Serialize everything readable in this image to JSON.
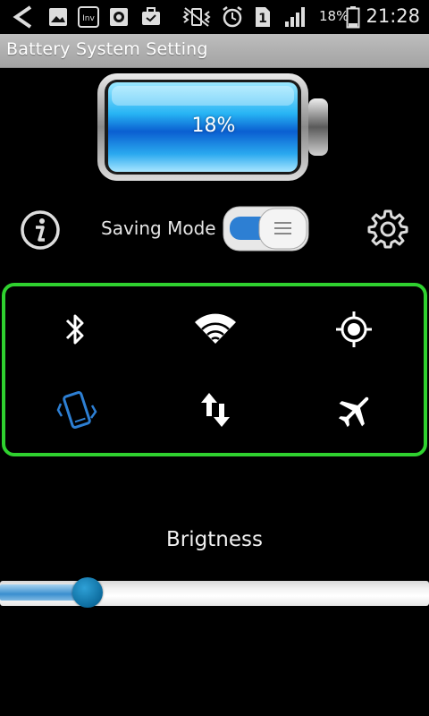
{
  "status_bar": {
    "battery_percent": "18%",
    "time": "21:28",
    "sim_slot": "1",
    "icons": [
      "back-arrow-icon",
      "gallery-icon",
      "inv-app-icon",
      "record-icon",
      "briefcase-icon",
      "mute-vibrate-icon",
      "alarm-icon",
      "sim-card-icon",
      "signal-icon",
      "battery-icon"
    ]
  },
  "title": "Battery System Setting",
  "battery": {
    "level_label": "18%",
    "level_value": 18
  },
  "controls": {
    "info_icon": "info-icon",
    "saving_mode_label": "Saving Mode",
    "saving_mode_on": true,
    "settings_icon": "gear-icon"
  },
  "quick_panel": {
    "border_color": "#2fd12f",
    "items": [
      {
        "name": "bluetooth",
        "icon": "bluetooth-icon",
        "active": false
      },
      {
        "name": "wifi",
        "icon": "wifi-icon",
        "active": false
      },
      {
        "name": "gps",
        "icon": "location-icon",
        "active": false
      },
      {
        "name": "vibrate",
        "icon": "vibrate-phone-icon",
        "active": true
      },
      {
        "name": "mobile-data",
        "icon": "data-transfer-icon",
        "active": false
      },
      {
        "name": "airplane-mode",
        "icon": "airplane-icon",
        "active": false
      }
    ],
    "active_color": "#2d7fd3"
  },
  "brightness": {
    "label": "Brigtness",
    "value": 0.2
  }
}
